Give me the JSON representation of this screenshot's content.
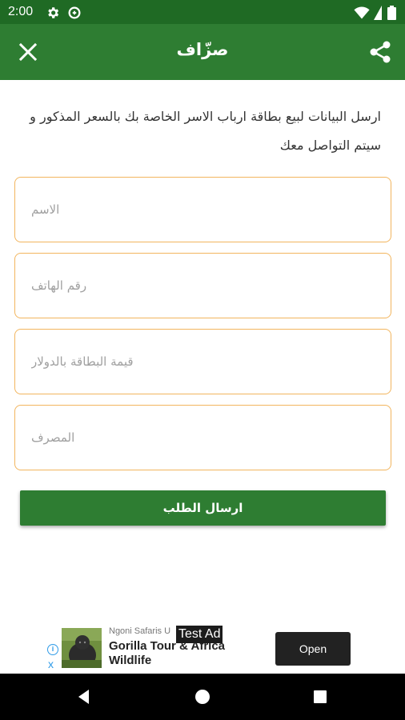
{
  "status_bar": {
    "time": "2:00"
  },
  "app_bar": {
    "title": "صزّاف"
  },
  "description": "ارسل البيانات لبيع بطاقة ارباب الاسر الخاصة بك بالسعر المذكور و سيتم التواصل معك",
  "form": {
    "fields": [
      {
        "placeholder": "الاسم"
      },
      {
        "placeholder": "رقم الهاتف"
      },
      {
        "placeholder": "قيمة البطاقة بالدولار"
      },
      {
        "placeholder": "المصرف"
      }
    ],
    "submit_label": "ارسال الطلب"
  },
  "ad": {
    "label": "Test Ad",
    "advertiser": "Ngoni Safaris U",
    "headline": "Gorilla Tour & Africa Wildlife",
    "cta": "Open",
    "choices_icon": "info-icon",
    "close_icon": "x"
  },
  "colors": {
    "status_bar": "#1f6a24",
    "app_bar": "#2e7d32",
    "button": "#2e7d32",
    "field_border": "#f2b55e",
    "placeholder": "#a0a0a0"
  },
  "icons": [
    "settings-icon",
    "data-saver-icon",
    "wifi-icon",
    "battery-icon",
    "close-icon",
    "share-icon",
    "back-icon",
    "home-icon",
    "recents-icon"
  ]
}
